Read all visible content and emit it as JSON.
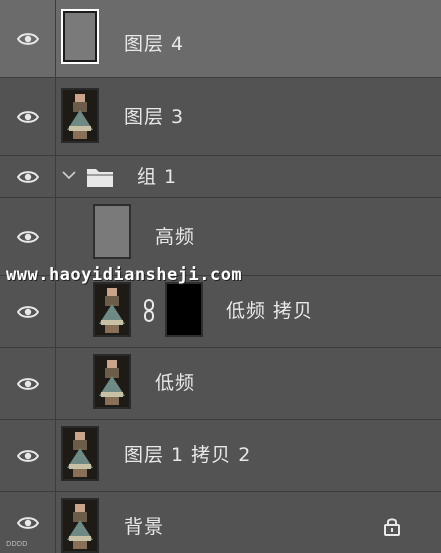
{
  "panel": {
    "name": "layers-panel"
  },
  "layers": [
    {
      "id": "layer-4",
      "label": "图层 4",
      "type": "layer",
      "thumb": "grey",
      "selected": true,
      "visible": true,
      "indent": 0
    },
    {
      "id": "layer-3",
      "label": "图层 3",
      "type": "layer",
      "thumb": "photo",
      "selected": false,
      "visible": true,
      "indent": 0
    },
    {
      "id": "group-1",
      "label": "组 1",
      "type": "group",
      "expanded": true,
      "selected": false,
      "visible": true,
      "indent": 0
    },
    {
      "id": "high-freq",
      "label": "高频",
      "type": "layer",
      "thumb": "grey",
      "selected": false,
      "visible": true,
      "indent": 1
    },
    {
      "id": "low-freq-copy",
      "label": "低频 拷贝",
      "type": "layer",
      "thumb": "photo",
      "mask": "black",
      "linked": true,
      "selected": false,
      "visible": true,
      "indent": 1
    },
    {
      "id": "low-freq",
      "label": "低频",
      "type": "layer",
      "thumb": "photo",
      "selected": false,
      "visible": true,
      "indent": 1
    },
    {
      "id": "layer-1-copy-2",
      "label": "图层 1 拷贝 2",
      "type": "layer",
      "thumb": "photo",
      "selected": false,
      "visible": true,
      "indent": 0
    },
    {
      "id": "background",
      "label": "背景",
      "type": "layer",
      "thumb": "photo",
      "locked": true,
      "selected": false,
      "visible": true,
      "indent": 0
    }
  ],
  "icons": {
    "eye": "eye-icon",
    "chevron": "chevron-down-icon",
    "folder": "folder-icon",
    "link": "link-icon",
    "lock": "lock-icon"
  },
  "watermark": {
    "text": "www.haoyidiansheji.com"
  },
  "corner_mark": {
    "text": "DDDD"
  },
  "colors": {
    "panel_bg": "#535353",
    "selected_bg": "#6b6b6b",
    "divider": "#3c3c3c",
    "text": "#e8e8e8"
  }
}
